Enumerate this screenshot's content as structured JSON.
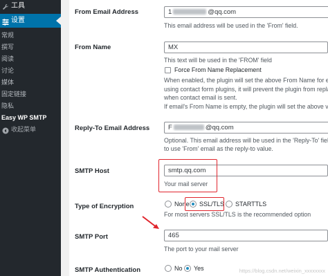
{
  "sidebar": {
    "tools_label": "工具",
    "settings_label": "设置",
    "submenu": [
      "常规",
      "撰写",
      "阅读",
      "讨论",
      "媒体",
      "固定链接",
      "隐私"
    ],
    "current_item": "Easy WP SMTP",
    "collapse_label": "收起菜单"
  },
  "from_email": {
    "label": "From Email Address",
    "value_prefix": "1",
    "value_suffix": "@qq.com",
    "help": "This email address will be used in the 'From' field."
  },
  "from_name": {
    "label": "From Name",
    "value": "MX",
    "help": "This text will be used in the 'FROM' field",
    "force_label": "Force From Name Replacement",
    "help_lines": [
      "When enabled, the plugin will set the above From Name for each",
      "using contact form plugins, it will prevent the plugin from repla",
      "when contact email is sent.",
      "If email's From Name is empty, the plugin will set the above valu"
    ]
  },
  "reply_to": {
    "label": "Reply-To Email Address",
    "value_prefix": "F",
    "value_suffix": "@qq.com",
    "help_lines": [
      "Optional. This email address will be used in the 'Reply-To' fiel",
      "to use 'From' email as the reply-to value."
    ]
  },
  "smtp_host": {
    "label": "SMTP Host",
    "value": "smtp.qq.com",
    "help": "Your mail server"
  },
  "encryption": {
    "label": "Type of Encryption",
    "options": [
      "None",
      "SSL/TLS",
      "STARTTLS"
    ],
    "selected": "SSL/TLS",
    "help": "For most servers SSL/TLS is the recommended option"
  },
  "smtp_port": {
    "label": "SMTP Port",
    "value": "465",
    "help": "The port to your mail server"
  },
  "smtp_auth": {
    "label": "SMTP Authentication",
    "options": [
      "No",
      "Yes"
    ],
    "selected": "Yes"
  },
  "watermark": "https://blog.csdn.net/weixin_xxxxxxxx",
  "colors": {
    "sidebar_bg": "#23282d",
    "accent": "#0073aa",
    "annotation_red": "#e0242c"
  }
}
